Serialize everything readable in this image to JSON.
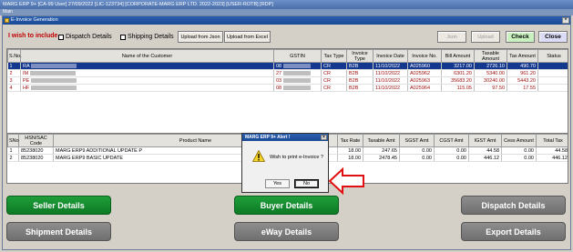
{
  "app": {
    "title": "MARG ERP 9+ [CA-99 User] 27/09/2022 [LIC-123734] [CORPORATE-MARG ERP LTD. 2022-2023] [USER-ROTB] [RDP]",
    "menu": "Main"
  },
  "dialog": {
    "title": "E-Invoice Generation",
    "wish_label": "I wish to include",
    "dispatch_details_label": "Dispatch Details",
    "shipping_details_label": "Shipping Details",
    "upload_json_label": "Upload from Json",
    "upload_excel_label": "Upload from Excel",
    "json_label": "Json",
    "upload_label": "Upload",
    "check_label": "Check",
    "close_label": "Close"
  },
  "invoices": {
    "columns": [
      "S.No.",
      "Name of the Customer",
      "GSTIN",
      "Tax Type",
      "Invoice Type",
      "Invoice Date",
      "Invoice No.",
      "Bill Amount",
      "Taxable Amount",
      "Tax Amount",
      "Status"
    ],
    "rows": [
      {
        "sno": "1",
        "name": "RA",
        "gstin": "08",
        "tax_type": "CR",
        "inv_type": "B2B",
        "date": "11/10/2022",
        "inv_no": "A025960",
        "bill": "3217.00",
        "taxable": "2726.10",
        "tax": "490.70",
        "status": ""
      },
      {
        "sno": "2",
        "name": "IM",
        "gstin": "27",
        "tax_type": "CR",
        "inv_type": "B2B",
        "date": "11/10/2022",
        "inv_no": "A025962",
        "bill": "6301.20",
        "taxable": "5340.00",
        "tax": "961.20",
        "status": ""
      },
      {
        "sno": "3",
        "name": "PE",
        "gstin": "03",
        "tax_type": "CR",
        "inv_type": "B2B",
        "date": "11/10/2022",
        "inv_no": "A025963",
        "bill": "35683.20",
        "taxable": "30240.00",
        "tax": "5443.20",
        "status": ""
      },
      {
        "sno": "4",
        "name": "HF",
        "gstin": "08",
        "tax_type": "CR",
        "inv_type": "B2B",
        "date": "11/10/2022",
        "inv_no": "A025964",
        "bill": "115.05",
        "taxable": "97.50",
        "tax": "17.55",
        "status": ""
      }
    ]
  },
  "products": {
    "columns": [
      "SNo",
      "HSN/SAC Code",
      "Product Name",
      "Tax Rate",
      "Taxable Amt",
      "SGST Amt",
      "CGST Amt",
      "IGST Amt",
      "Cess Amount",
      "Total Tax"
    ],
    "rows": [
      {
        "sno": "1",
        "hsn": "85238020",
        "name": "MARG ERP9 ADDITIONAL UPDATE P",
        "rate": "18.00",
        "taxable": "247.65",
        "sgst": "0.00",
        "cgst": "0.00",
        "igst": "44.58",
        "cess": "0.00",
        "total": "44.58"
      },
      {
        "sno": "2",
        "hsn": "85238020",
        "name": "MARG ERP9 BASIC UPDATE",
        "rate": "18.00",
        "taxable": "2478.45",
        "sgst": "0.00",
        "cgst": "0.00",
        "igst": "446.12",
        "cess": "0.00",
        "total": "446.12"
      }
    ]
  },
  "buttons": {
    "seller": "Seller Details",
    "buyer": "Buyer Details",
    "dispatch": "Dispatch Details",
    "shipment": "Shipment Details",
    "eway": "eWay Details",
    "export": "Export Details"
  },
  "alert": {
    "title": "MARG ERP 9+ Alert !",
    "message": "Wish to print e-Invoice ?",
    "yes_label": "Yes",
    "no_label": "No"
  },
  "colors": {
    "green": "#0d7a25",
    "gray": "#6f6f6f",
    "selection": "#15388f",
    "highlight_arrow": "#e01010"
  }
}
